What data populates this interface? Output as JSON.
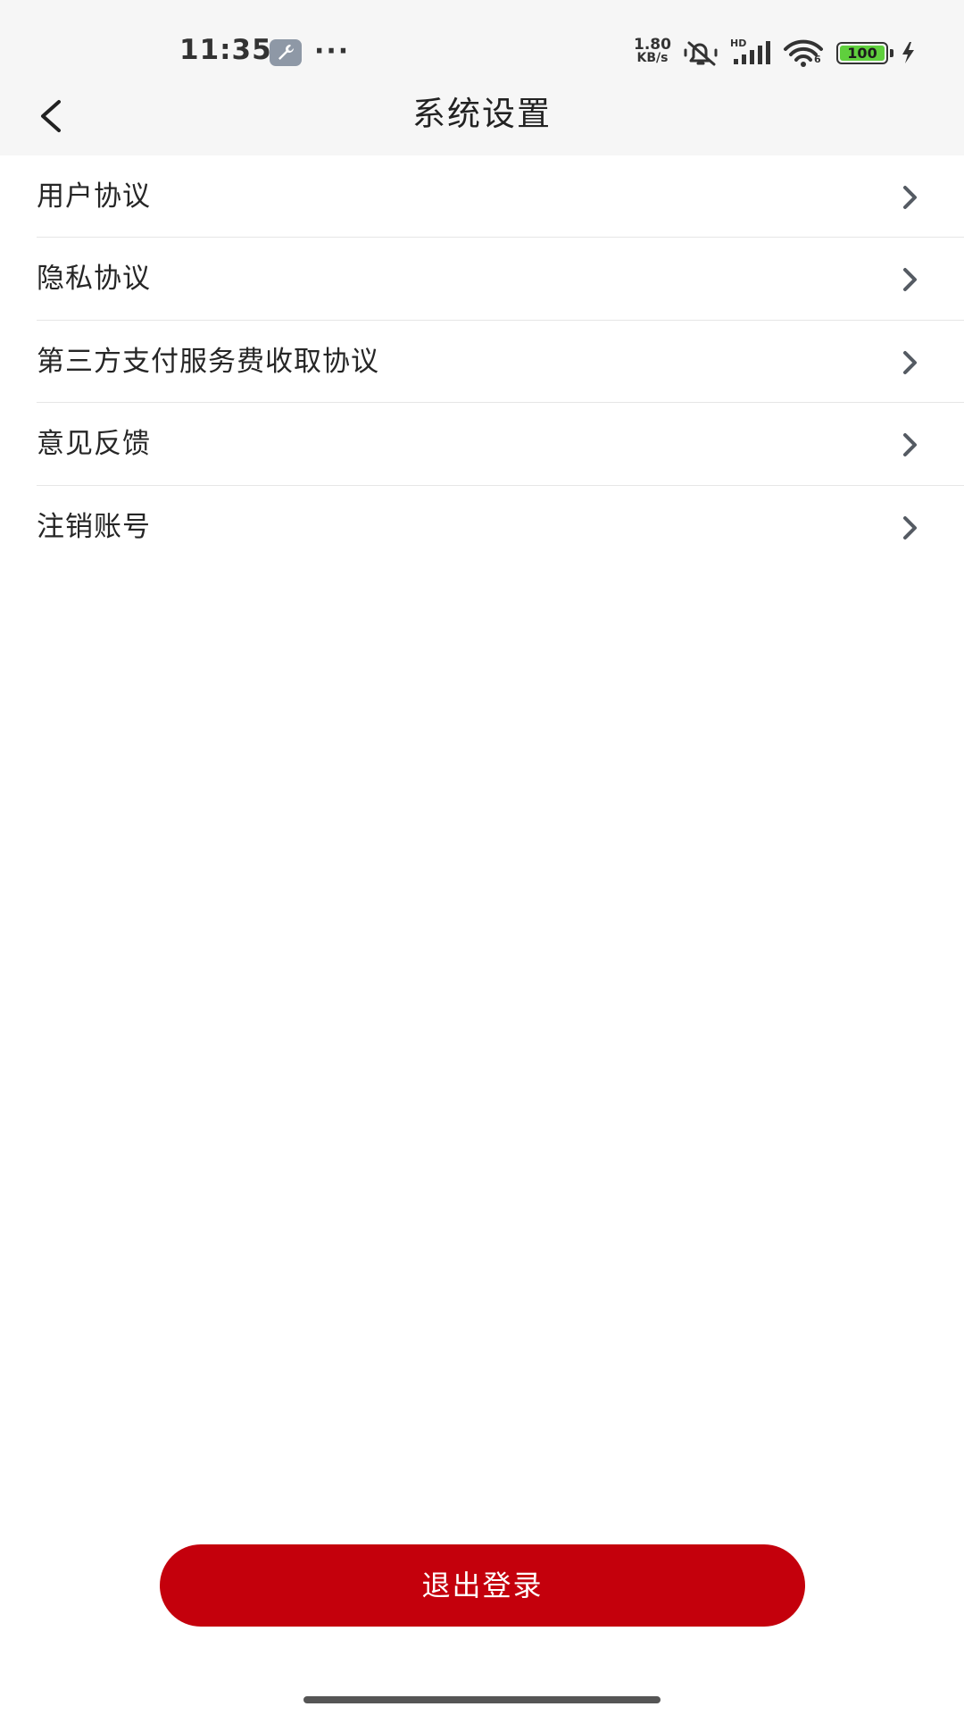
{
  "status_bar": {
    "time": "11:35",
    "more": "···",
    "net_speed_value": "1.80",
    "net_speed_unit": "KB/s",
    "signal_label": "HD",
    "wifi_label": "6",
    "battery_level": "100",
    "icons": [
      "wrench-icon",
      "mute-icon",
      "signal-icon",
      "wifi-icon",
      "battery-icon",
      "charging-icon"
    ]
  },
  "header": {
    "title": "系统设置",
    "back_icon": "chevron-left-icon"
  },
  "menu": {
    "items": [
      {
        "label": "用户协议"
      },
      {
        "label": "隐私协议"
      },
      {
        "label": "第三方支付服务费收取协议"
      },
      {
        "label": "意见反馈"
      },
      {
        "label": "注销账号"
      }
    ],
    "item_icon": "chevron-right-icon"
  },
  "actions": {
    "logout_label": "退出登录"
  },
  "colors": {
    "accent": "#c4000c",
    "header_bg": "#f6f6f6",
    "battery_fill": "#5fcf3d",
    "divider": "#e6e6e6"
  }
}
